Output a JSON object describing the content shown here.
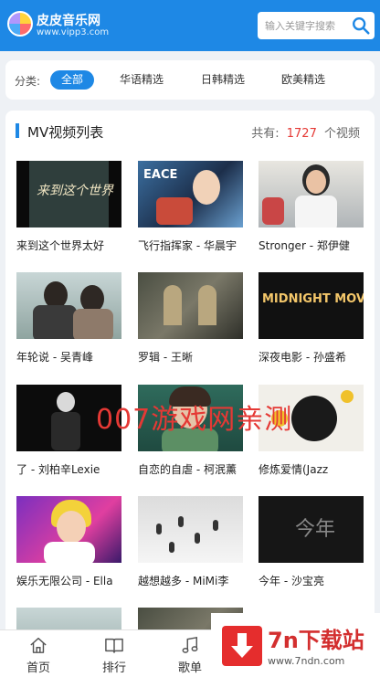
{
  "header": {
    "site_name": "皮皮音乐网",
    "site_url": "www.vipp3.com",
    "search_placeholder": "输入关键字搜索"
  },
  "categories": {
    "label": "分类:",
    "items": [
      "全部",
      "华语精选",
      "日韩精选",
      "欧美精选"
    ],
    "active": "全部"
  },
  "video_list": {
    "title": "MV视频列表",
    "count_prefix": "共有:",
    "count": "1727",
    "count_suffix": "个视频",
    "videos": [
      {
        "title": "来到这个世界太好",
        "thumb_text": "来到这个世界"
      },
      {
        "title": "飞行指挥家 - 华晨宇",
        "thumb_text": "EACE"
      },
      {
        "title": "Stronger - 郑伊健",
        "thumb_text": ""
      },
      {
        "title": "年轮说 - 吴青峰",
        "thumb_text": ""
      },
      {
        "title": "罗辑 - 王晰",
        "thumb_text": ""
      },
      {
        "title": "深夜电影 - 孙盛希",
        "thumb_text": "MIDNIGHT MOVIE"
      },
      {
        "title": "了 - 刘柏辛Lexie",
        "thumb_text": ""
      },
      {
        "title": "自恋的自虐 - 柯泯薰",
        "thumb_text": ""
      },
      {
        "title": "修炼爱情(Jazz",
        "thumb_text": ""
      },
      {
        "title": "娱乐无限公司 - Ella",
        "thumb_text": ""
      },
      {
        "title": "越想越多 - MiMi李",
        "thumb_text": ""
      },
      {
        "title": "今年 - 沙宝亮",
        "thumb_text": "今年"
      }
    ]
  },
  "watermark": "007游戏网亲测",
  "bottom_nav": {
    "items": [
      {
        "label": "首页",
        "icon": "home-icon"
      },
      {
        "label": "排行",
        "icon": "book-icon"
      },
      {
        "label": "歌单",
        "icon": "music-note-icon"
      }
    ]
  },
  "ad": {
    "name": "7n下载站",
    "url": "www.7ndn.com"
  },
  "colors": {
    "primary": "#1e88e5",
    "count_red": "#e53935",
    "ad_red": "#d32f2f"
  }
}
